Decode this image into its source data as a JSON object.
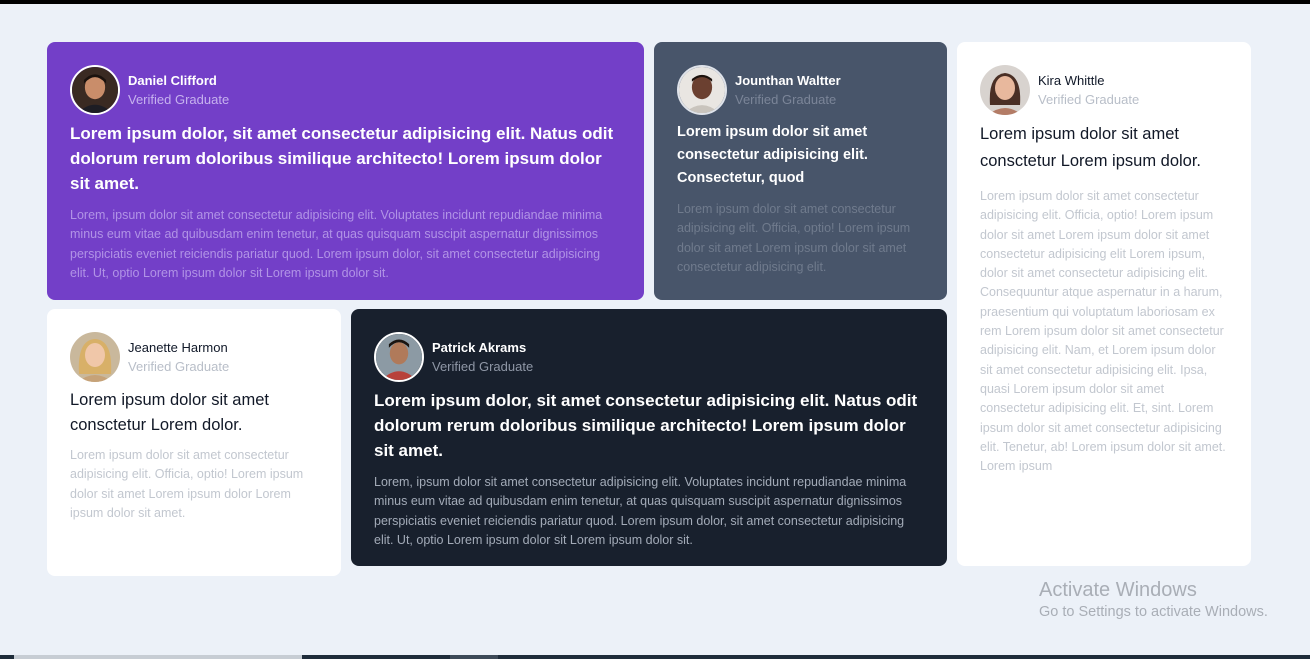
{
  "testimonials": [
    {
      "name": "Daniel Clifford",
      "role": "Verified Graduate",
      "avatar_icon": "avatar-daniel",
      "headline": "Lorem ipsum dolor, sit amet consectetur adipisicing elit. Natus odit dolorum rerum doloribus similique architecto! Lorem ipsum dolor sit amet.",
      "body": "Lorem, ipsum dolor sit amet consectetur adipisicing elit. Voluptates incidunt repudiandae minima minus eum vitae ad quibusdam enim tenetur, at quas quisquam suscipit aspernatur dignissimos perspiciatis eveniet reiciendis pariatur quod. Lorem ipsum dolor, sit amet consectetur adipisicing elit. Ut, optio Lorem ipsum dolor sit Lorem ipsum dolor sit.",
      "background": "#733fc8"
    },
    {
      "name": "Jounthan Waltter",
      "role": "Verified Graduate",
      "avatar_icon": "avatar-jounthan",
      "headline": "Lorem ipsum dolor sit amet consectetur adipisicing elit. Consectetur, quod",
      "body": "Lorem ipsum dolor sit amet consectetur adipisicing elit. Officia, optio! Lorem ipsum dolor sit amet Lorem ipsum dolor sit amet consectetur adipisicing elit.",
      "background": "#48556a"
    },
    {
      "name": "Kira Whittle",
      "role": "Verified Graduate",
      "avatar_icon": "avatar-kira",
      "headline": "Lorem ipsum dolor sit amet consctetur Lorem ipsum dolor.",
      "body": "Lorem ipsum dolor sit amet consectetur adipisicing elit. Officia, optio! Lorem ipsum dolor sit amet Lorem ipsum dolor sit amet consectetur adipisicing elit Lorem ipsum, dolor sit amet consectetur adipisicing elit. Consequuntur atque aspernatur in a harum, praesentium qui voluptatum laboriosam ex rem Lorem ipsum dolor sit amet consectetur adipisicing elit. Nam, et Lorem ipsum dolor sit amet consectetur adipisicing elit. Ipsa, quasi Lorem ipsum dolor sit amet consectetur adipisicing elit. Et, sint. Lorem ipsum dolor sit amet consectetur adipisicing elit. Tenetur, ab! Lorem ipsum dolor sit amet. Lorem ipsum",
      "background": "#ffffff"
    },
    {
      "name": "Jeanette Harmon",
      "role": "Verified Graduate",
      "avatar_icon": "avatar-jeanette",
      "headline": "Lorem ipsum dolor sit amet consctetur Lorem dolor.",
      "body": "Lorem ipsum dolor sit amet consectetur adipisicing elit. Officia, optio! Lorem ipsum dolor sit amet Lorem ipsum dolor Lorem ipsum dolor sit amet.",
      "background": "#ffffff"
    },
    {
      "name": "Patrick Akrams",
      "role": "Verified Graduate",
      "avatar_icon": "avatar-patrick",
      "headline": "Lorem ipsum dolor, sit amet consectetur adipisicing elit. Natus odit dolorum rerum doloribus similique architecto! Lorem ipsum dolor sit amet.",
      "body": "Lorem, ipsum dolor sit amet consectetur adipisicing elit. Voluptates incidunt repudiandae minima minus eum vitae ad quibusdam enim tenetur, at quas quisquam suscipit aspernatur dignissimos perspiciatis eveniet reiciendis pariatur quod. Lorem ipsum dolor, sit amet consectetur adipisicing elit. Ut, optio Lorem ipsum dolor sit Lorem ipsum dolor sit.",
      "background": "#18202d"
    }
  ],
  "watermark": {
    "title": "Activate Windows",
    "subtitle": "Go to Settings to activate Windows."
  }
}
